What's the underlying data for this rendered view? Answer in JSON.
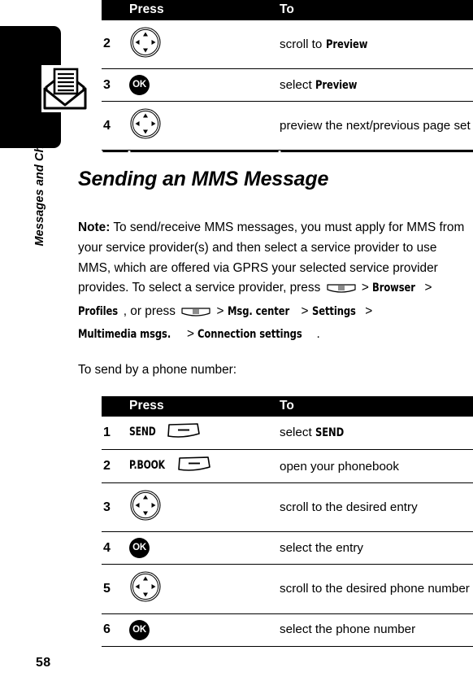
{
  "page": {
    "number": "58",
    "chapter_tab_label": "Messages and Chat",
    "chapter_icon": "envelope-message-icon"
  },
  "table_top": {
    "headers": {
      "press": "Press",
      "to": "To"
    },
    "rows": [
      {
        "num": "2",
        "key": "nav-key-icon",
        "action_prefix": "scroll to ",
        "action_menu": "Preview",
        "action_suffix": ""
      },
      {
        "num": "3",
        "key": "ok-key-icon",
        "action_prefix": "select ",
        "action_menu": "Preview",
        "action_suffix": ""
      },
      {
        "num": "4",
        "key": "nav-key-icon",
        "action_prefix": "preview the next/previous page set",
        "action_menu": "",
        "action_suffix": ""
      }
    ]
  },
  "section": {
    "title": "Sending an MMS Message",
    "note_label": "Note:",
    "note_text_1": " To send/receive MMS messages, you must apply for MMS from your service provider(s) and then select a service provider to use MMS, which are offered via GPRS your selected service provider provides. To select a service provider, press ",
    "note_text_2": " > ",
    "note_menu_1": "Browser",
    "note_text_3": " > ",
    "note_menu_2": "Profiles",
    "note_text_4": ", or press ",
    "note_text_5": " > ",
    "note_menu_3": "Msg. center",
    "note_text_6": " > ",
    "note_menu_4": "Settings",
    "note_text_7": " > ",
    "note_menu_5": "Multimedia msgs.",
    "note_text_8": " > ",
    "note_menu_6": "Connection settings",
    "note_text_9": ".",
    "menu_key_icon": "menu-key-icon",
    "lead_line": "To send by a phone number:"
  },
  "table_bottom": {
    "headers": {
      "press": "Press",
      "to": "To"
    },
    "rows": [
      {
        "num": "1",
        "softkey_label": "SEND",
        "key": "soft-key-icon",
        "action_prefix": "select ",
        "action_menu": "SEND",
        "action_suffix": ""
      },
      {
        "num": "2",
        "softkey_label": "P.BOOK",
        "key": "soft-key-icon",
        "action_prefix": "open your phonebook",
        "action_menu": "",
        "action_suffix": ""
      },
      {
        "num": "3",
        "softkey_label": "",
        "key": "nav-key-icon",
        "action_prefix": "scroll to the desired entry",
        "action_menu": "",
        "action_suffix": ""
      },
      {
        "num": "4",
        "softkey_label": "",
        "key": "ok-key-icon",
        "action_prefix": "select the entry",
        "action_menu": "",
        "action_suffix": ""
      },
      {
        "num": "5",
        "softkey_label": "",
        "key": "nav-key-icon",
        "action_prefix": "scroll to the desired phone number",
        "action_menu": "",
        "action_suffix": ""
      },
      {
        "num": "6",
        "softkey_label": "",
        "key": "ok-key-icon",
        "action_prefix": "select the phone number",
        "action_menu": "",
        "action_suffix": ""
      }
    ]
  },
  "colors": {
    "ink": "#000000",
    "paper": "#ffffff"
  }
}
